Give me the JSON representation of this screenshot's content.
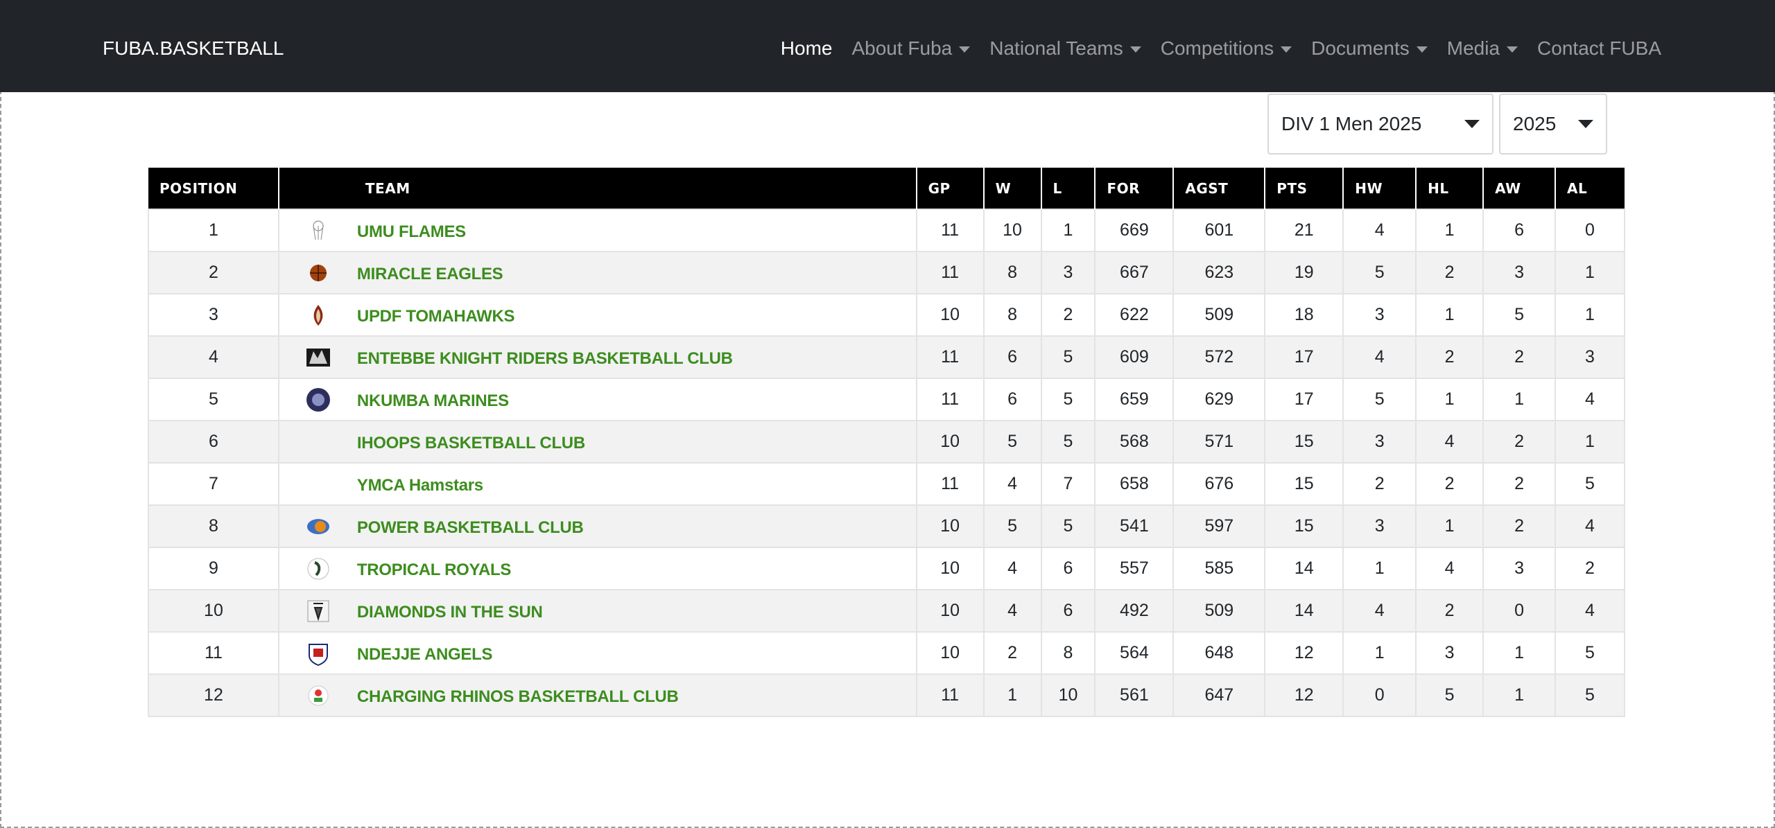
{
  "navbar": {
    "brand": "FUBA.BASKETBALL",
    "items": [
      {
        "label": "Home",
        "active": true,
        "dropdown": false
      },
      {
        "label": "About Fuba",
        "active": false,
        "dropdown": true
      },
      {
        "label": "National Teams",
        "active": false,
        "dropdown": true
      },
      {
        "label": "Competitions",
        "active": false,
        "dropdown": true
      },
      {
        "label": "Documents",
        "active": false,
        "dropdown": true
      },
      {
        "label": "Media",
        "active": false,
        "dropdown": true
      },
      {
        "label": "Contact FUBA",
        "active": false,
        "dropdown": false
      }
    ]
  },
  "filters": {
    "division": "DIV 1 Men 2025",
    "year": "2025"
  },
  "table": {
    "headers": [
      "POSITION",
      "TEAM",
      "GP",
      "W",
      "L",
      "FOR",
      "AGST",
      "PTS",
      "HW",
      "HL",
      "AW",
      "AL"
    ],
    "rows": [
      {
        "pos": "1",
        "team": "UMU FLAMES",
        "logo": "umu-flames-logo",
        "gp": "11",
        "w": "10",
        "l": "1",
        "for": "669",
        "agst": "601",
        "pts": "21",
        "hw": "4",
        "hl": "1",
        "aw": "6",
        "al": "0"
      },
      {
        "pos": "2",
        "team": "MIRACLE EAGLES",
        "logo": "miracle-eagles-logo",
        "gp": "11",
        "w": "8",
        "l": "3",
        "for": "667",
        "agst": "623",
        "pts": "19",
        "hw": "5",
        "hl": "2",
        "aw": "3",
        "al": "1"
      },
      {
        "pos": "3",
        "team": "UPDF TOMAHAWKS",
        "logo": "updf-tomahawks-logo",
        "gp": "10",
        "w": "8",
        "l": "2",
        "for": "622",
        "agst": "509",
        "pts": "18",
        "hw": "3",
        "hl": "1",
        "aw": "5",
        "al": "1"
      },
      {
        "pos": "4",
        "team": "ENTEBBE KNIGHT RIDERS BASKETBALL CLUB",
        "logo": "entebbe-knight-riders-logo",
        "gp": "11",
        "w": "6",
        "l": "5",
        "for": "609",
        "agst": "572",
        "pts": "17",
        "hw": "4",
        "hl": "2",
        "aw": "2",
        "al": "3"
      },
      {
        "pos": "5",
        "team": "NKUMBA MARINES",
        "logo": "nkumba-marines-logo",
        "gp": "11",
        "w": "6",
        "l": "5",
        "for": "659",
        "agst": "629",
        "pts": "17",
        "hw": "5",
        "hl": "1",
        "aw": "1",
        "al": "4"
      },
      {
        "pos": "6",
        "team": "IHOOPS BASKETBALL CLUB",
        "logo": "",
        "gp": "10",
        "w": "5",
        "l": "5",
        "for": "568",
        "agst": "571",
        "pts": "15",
        "hw": "3",
        "hl": "4",
        "aw": "2",
        "al": "1"
      },
      {
        "pos": "7",
        "team": "YMCA Hamstars",
        "logo": "",
        "gp": "11",
        "w": "4",
        "l": "7",
        "for": "658",
        "agst": "676",
        "pts": "15",
        "hw": "2",
        "hl": "2",
        "aw": "2",
        "al": "5"
      },
      {
        "pos": "8",
        "team": "POWER BASKETBALL CLUB",
        "logo": "power-basketball-logo",
        "gp": "10",
        "w": "5",
        "l": "5",
        "for": "541",
        "agst": "597",
        "pts": "15",
        "hw": "3",
        "hl": "1",
        "aw": "2",
        "al": "4"
      },
      {
        "pos": "9",
        "team": "TROPICAL ROYALS",
        "logo": "tropical-royals-logo",
        "gp": "10",
        "w": "4",
        "l": "6",
        "for": "557",
        "agst": "585",
        "pts": "14",
        "hw": "1",
        "hl": "4",
        "aw": "3",
        "al": "2"
      },
      {
        "pos": "10",
        "team": "DIAMONDS IN THE SUN",
        "logo": "diamonds-in-the-sun-logo",
        "gp": "10",
        "w": "4",
        "l": "6",
        "for": "492",
        "agst": "509",
        "pts": "14",
        "hw": "4",
        "hl": "2",
        "aw": "0",
        "al": "4"
      },
      {
        "pos": "11",
        "team": "NDEJJE ANGELS",
        "logo": "ndejje-angels-logo",
        "gp": "10",
        "w": "2",
        "l": "8",
        "for": "564",
        "agst": "648",
        "pts": "12",
        "hw": "1",
        "hl": "3",
        "aw": "1",
        "al": "5"
      },
      {
        "pos": "12",
        "team": "CHARGING RHINOS BASKETBALL CLUB",
        "logo": "charging-rhinos-logo",
        "gp": "11",
        "w": "1",
        "l": "10",
        "for": "561",
        "agst": "647",
        "pts": "12",
        "hw": "0",
        "hl": "5",
        "aw": "1",
        "al": "5"
      }
    ]
  },
  "colors": {
    "navbar_bg": "#212529",
    "team_link": "#3c8d1e",
    "header_bg": "#000000",
    "row_alt": "#f2f2f2"
  }
}
